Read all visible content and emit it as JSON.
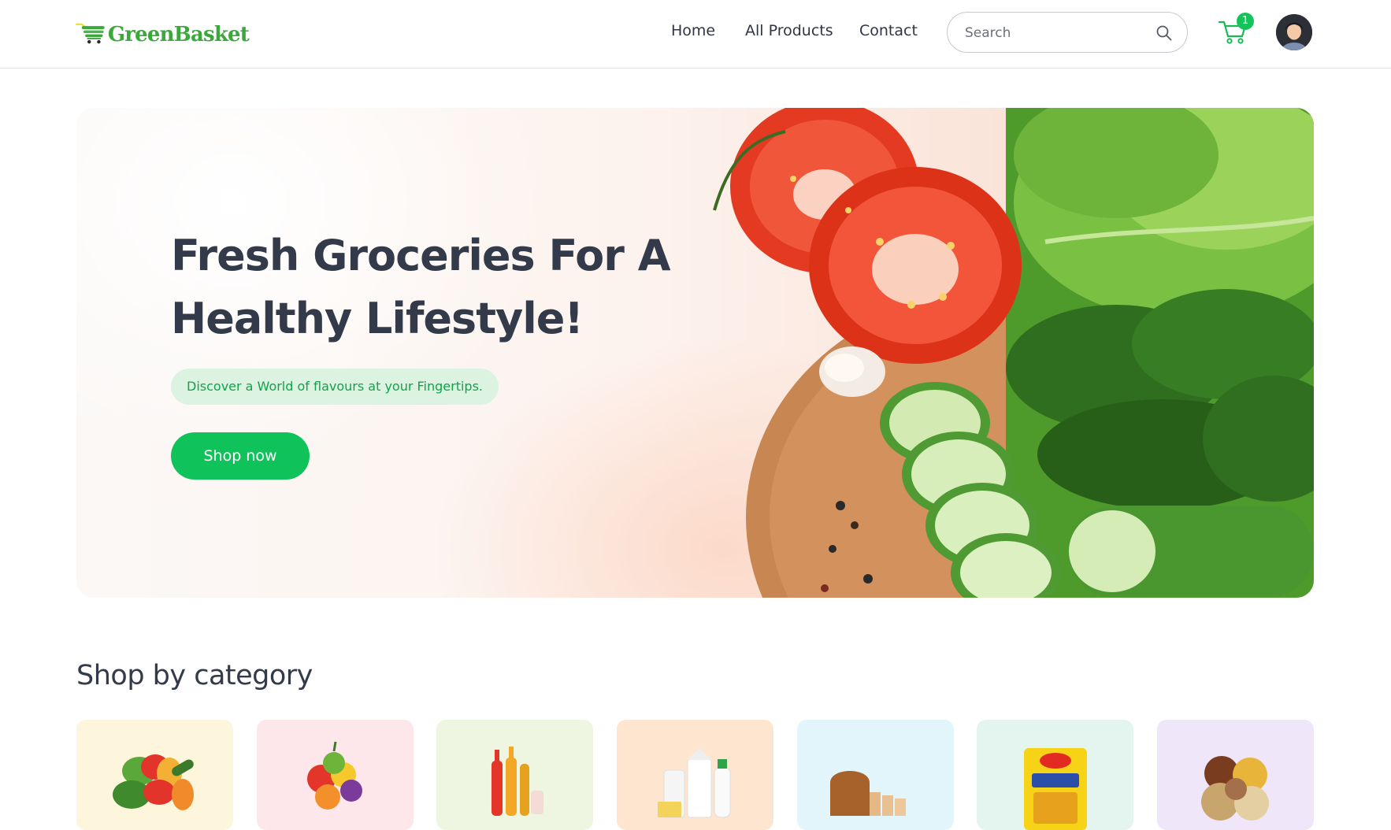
{
  "header": {
    "logo_text": "GreenBasket",
    "nav": [
      {
        "label": "Home"
      },
      {
        "label": "All Products"
      },
      {
        "label": "Contact"
      }
    ],
    "search": {
      "placeholder": "Search",
      "value": ""
    },
    "cart": {
      "count": "1"
    },
    "icons": [
      "cart-icon",
      "search-icon",
      "avatar"
    ]
  },
  "hero": {
    "title_line1": "Fresh Groceries For A",
    "title_line2": "Healthy Lifestyle!",
    "tagline": "Discover a World of flavours at your Fingertips.",
    "cta_label": "Shop now"
  },
  "categories": {
    "title": "Shop by category",
    "items": [
      {
        "icon": "vegetables-icon",
        "bg": "#fef6dc"
      },
      {
        "icon": "fruits-icon",
        "bg": "#fde7ea"
      },
      {
        "icon": "drinks-icon",
        "bg": "#eef6e2"
      },
      {
        "icon": "dairy-icon",
        "bg": "#fde5cf"
      },
      {
        "icon": "bakery-icon",
        "bg": "#e2f5fb"
      },
      {
        "icon": "instant-food-icon",
        "bg": "#e3f5ee"
      },
      {
        "icon": "grains-icon",
        "bg": "#efe6f9"
      }
    ]
  },
  "colors": {
    "brand": "#0fc35a",
    "logo": "#3aa83a",
    "text": "#333a4a",
    "pill_bg": "#dcf3e2",
    "pill_text": "#12a34a"
  }
}
